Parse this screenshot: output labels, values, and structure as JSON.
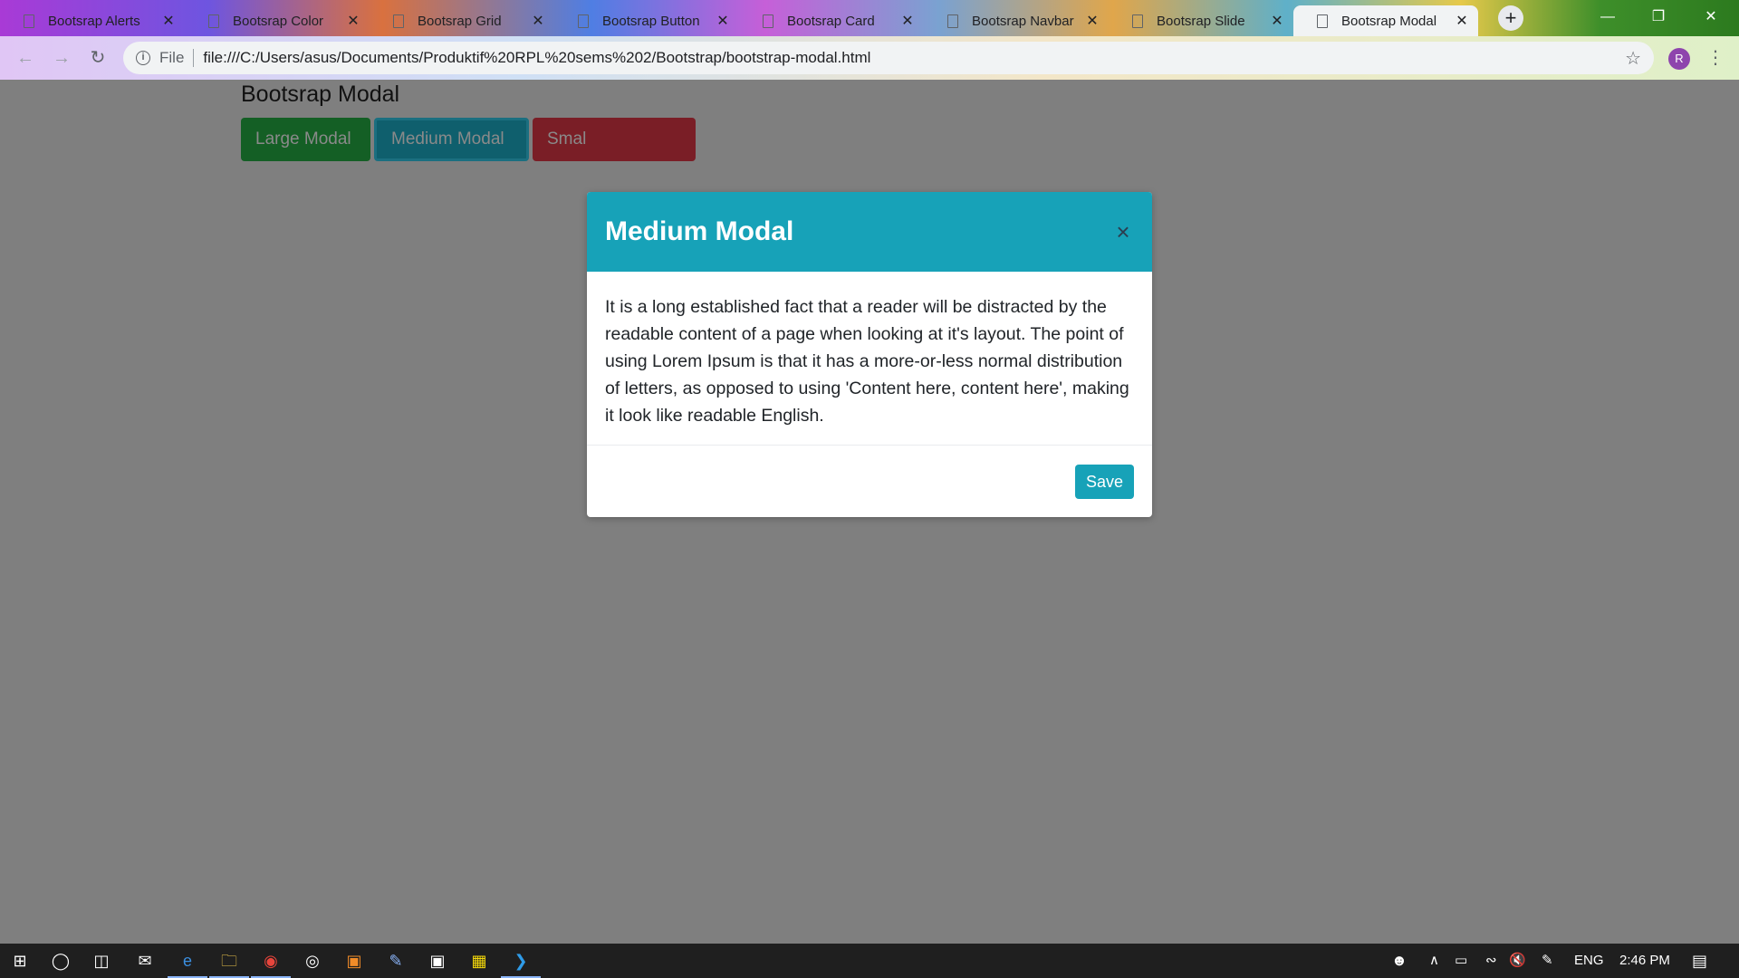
{
  "browser": {
    "tabs": [
      {
        "label": "Bootsrap Alerts",
        "active": false
      },
      {
        "label": "Bootsrap Color",
        "active": false
      },
      {
        "label": "Bootsrap Grid",
        "active": false
      },
      {
        "label": "Bootsrap Button",
        "active": false
      },
      {
        "label": "Bootsrap Card",
        "active": false
      },
      {
        "label": "Bootsrap Navbar",
        "active": false
      },
      {
        "label": "Bootsrap Slide",
        "active": false
      },
      {
        "label": "Bootsrap Modal",
        "active": true
      }
    ],
    "new_tab_icon": "+",
    "tab_close_icon": "✕",
    "address": {
      "scheme_label": "File",
      "url": "file:///C:/Users/asus/Documents/Produktif%20RPL%20sems%202/Bootstrap/bootstrap-modal.html"
    },
    "profile_initial": "R"
  },
  "page": {
    "title": "Bootsrap Modal",
    "buttons": {
      "large": "Large Modal",
      "medium": "Medium Modal",
      "small": "Smal"
    }
  },
  "modal": {
    "title": "Medium Modal",
    "close_icon": "×",
    "body": "It is a long established fact that a reader will be distracted by the readable content of a page when looking at it's layout. The point of using Lorem Ipsum is that it has a more-or-less normal distribution of letters, as opposed to using 'Content here, content here', making it look like readable English.",
    "save_label": "Save",
    "accent_color": "#17a2b8"
  },
  "taskbar": {
    "language": "ENG",
    "time": "2:46 PM"
  }
}
